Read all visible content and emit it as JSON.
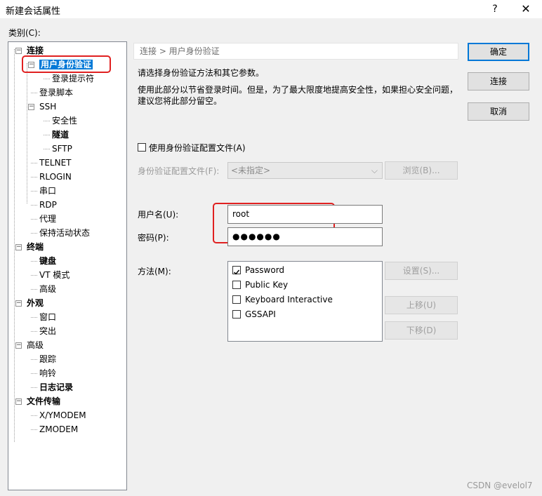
{
  "window": {
    "title": "新建会话属性",
    "help_glyph": "?",
    "close_glyph": "✕"
  },
  "category_label": "类别(C):",
  "tree": [
    {
      "label": "连接",
      "bold": true
    },
    {
      "label": "用户身份验证",
      "bold": true,
      "selected": true
    },
    {
      "label": "登录提示符"
    },
    {
      "label": "登录脚本"
    },
    {
      "label": "SSH"
    },
    {
      "label": "安全性"
    },
    {
      "label": "隧道",
      "bold": true
    },
    {
      "label": "SFTP"
    },
    {
      "label": "TELNET"
    },
    {
      "label": "RLOGIN"
    },
    {
      "label": "串口"
    },
    {
      "label": "RDP"
    },
    {
      "label": "代理"
    },
    {
      "label": "保持活动状态"
    },
    {
      "label": "终端",
      "bold": true
    },
    {
      "label": "键盘",
      "bold": true
    },
    {
      "label": "VT 模式"
    },
    {
      "label": "高级"
    },
    {
      "label": "外观",
      "bold": true
    },
    {
      "label": "窗口"
    },
    {
      "label": "突出"
    },
    {
      "label": "高级"
    },
    {
      "label": "跟踪"
    },
    {
      "label": "响铃"
    },
    {
      "label": "日志记录",
      "bold": true
    },
    {
      "label": "文件传输",
      "bold": true
    },
    {
      "label": "X/YMODEM"
    },
    {
      "label": "ZMODEM"
    }
  ],
  "breadcrumb": "连接 > 用户身份验证",
  "description": {
    "line1": "请选择身份验证方法和其它参数。",
    "line2": "使用此部分以节省登录时间。但是，为了最大限度地提高安全性，如果担心安全问题，",
    "line3": "建议您将此部分留空。"
  },
  "use_profile": {
    "label": "使用身份验证配置文件(A)",
    "checked": false
  },
  "profile": {
    "label": "身份验证配置文件(F):",
    "value": "<未指定>",
    "browse_label": "浏览(B)..."
  },
  "username": {
    "label": "用户名(U):",
    "value": "root"
  },
  "password": {
    "label": "密码(P):",
    "value": "●●●●●●"
  },
  "method": {
    "label": "方法(M):",
    "items": [
      {
        "label": "Password",
        "checked": true
      },
      {
        "label": "Public Key",
        "checked": false
      },
      {
        "label": "Keyboard Interactive",
        "checked": false
      },
      {
        "label": "GSSAPI",
        "checked": false
      }
    ],
    "settings_label": "设置(S)...",
    "up_label": "上移(U)",
    "down_label": "下移(D)"
  },
  "buttons": {
    "ok": "确定",
    "connect": "连接",
    "cancel": "取消"
  },
  "watermark": "CSDN @evelol7",
  "colors": {
    "selection": "#0078d7",
    "annotation": "#e02020"
  }
}
